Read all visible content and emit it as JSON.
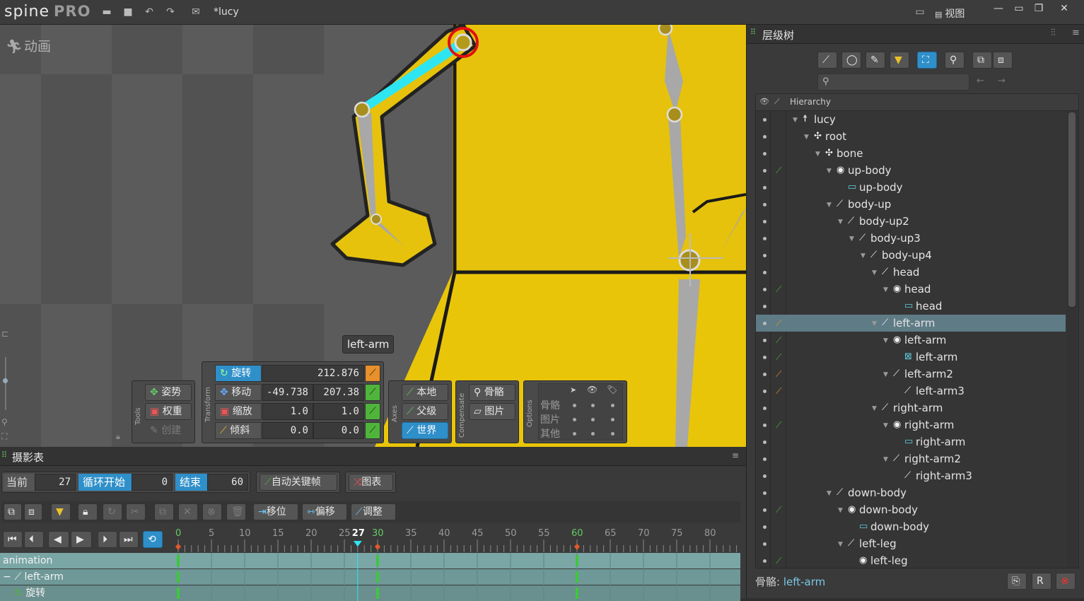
{
  "app": {
    "logo": "spine",
    "edition": "PRO",
    "filename": "*lucy",
    "view_menu": "视图"
  },
  "viewport": {
    "title": "动画",
    "bone_label": "left-arm"
  },
  "tools": {
    "label": "Tools",
    "pose": "姿势",
    "weights": "权重",
    "create": "创建"
  },
  "transform": {
    "label": "Transform",
    "rows": [
      {
        "name": "旋转",
        "v1": "212.876",
        "v2": "",
        "key": "orange",
        "active": true
      },
      {
        "name": "移动",
        "v1": "-49.738",
        "v2": "207.38",
        "key": "green",
        "active": false
      },
      {
        "name": "缩放",
        "v1": "1.0",
        "v2": "1.0",
        "key": "green",
        "active": false
      },
      {
        "name": "倾斜",
        "v1": "0.0",
        "v2": "0.0",
        "key": "green",
        "active": false
      }
    ]
  },
  "axes": {
    "label": "Axes",
    "local": "本地",
    "parent": "父级",
    "world": "世界"
  },
  "compensate": {
    "label": "Compensate",
    "bones": "骨骼",
    "images": "图片"
  },
  "options": {
    "label": "Options",
    "rows": [
      "骨骼",
      "图片",
      "其他"
    ]
  },
  "timeline": {
    "title": "摄影表",
    "current_label": "当前",
    "current": "27",
    "loop_start_label": "循环开始",
    "loop_start": "0",
    "end_label": "结束",
    "end": "60",
    "autokey": "自动关键帧",
    "graph": "图表",
    "offset_btn": "移位",
    "shift_btn": "偏移",
    "adjust_btn": "调整",
    "ticks": [
      "0",
      "5",
      "10",
      "15",
      "20",
      "25",
      "27",
      "30",
      "35",
      "40",
      "45",
      "50",
      "55",
      "60",
      "65",
      "70",
      "75",
      "80"
    ],
    "tracks": [
      "animation",
      "left-arm",
      "旋转"
    ]
  },
  "tree": {
    "title": "层级树",
    "column": "Hierarchy",
    "status_prefix": "骨骼:",
    "status_value": "left-arm",
    "items": [
      {
        "label": "lucy",
        "depth": 0,
        "icon": "skeleton",
        "key": ""
      },
      {
        "label": "root",
        "depth": 1,
        "icon": "bone-root",
        "key": ""
      },
      {
        "label": "bone",
        "depth": 2,
        "icon": "bone-root",
        "key": ""
      },
      {
        "label": "up-body",
        "depth": 3,
        "icon": "slot",
        "key": "green"
      },
      {
        "label": "up-body",
        "depth": 4,
        "icon": "image",
        "key": ""
      },
      {
        "label": "body-up",
        "depth": 3,
        "icon": "bone",
        "key": ""
      },
      {
        "label": "body-up2",
        "depth": 4,
        "icon": "bone",
        "key": ""
      },
      {
        "label": "body-up3",
        "depth": 5,
        "icon": "bone",
        "key": ""
      },
      {
        "label": "body-up4",
        "depth": 6,
        "icon": "bone",
        "key": ""
      },
      {
        "label": "head",
        "depth": 7,
        "icon": "bone",
        "key": ""
      },
      {
        "label": "head",
        "depth": 8,
        "icon": "slot",
        "key": "green"
      },
      {
        "label": "head",
        "depth": 9,
        "icon": "image",
        "key": ""
      },
      {
        "label": "left-arm",
        "depth": 7,
        "icon": "bone",
        "key": "orange",
        "selected": true
      },
      {
        "label": "left-arm",
        "depth": 8,
        "icon": "slot",
        "key": "green"
      },
      {
        "label": "left-arm",
        "depth": 9,
        "icon": "mesh",
        "key": "green"
      },
      {
        "label": "left-arm2",
        "depth": 8,
        "icon": "bone",
        "key": "orange"
      },
      {
        "label": "left-arm3",
        "depth": 9,
        "icon": "bone",
        "key": "orange"
      },
      {
        "label": "right-arm",
        "depth": 7,
        "icon": "bone",
        "key": ""
      },
      {
        "label": "right-arm",
        "depth": 8,
        "icon": "slot",
        "key": "green"
      },
      {
        "label": "right-arm",
        "depth": 9,
        "icon": "image",
        "key": ""
      },
      {
        "label": "right-arm2",
        "depth": 8,
        "icon": "bone",
        "key": ""
      },
      {
        "label": "right-arm3",
        "depth": 9,
        "icon": "bone",
        "key": ""
      },
      {
        "label": "down-body",
        "depth": 3,
        "icon": "bone",
        "key": ""
      },
      {
        "label": "down-body",
        "depth": 4,
        "icon": "slot",
        "key": "green"
      },
      {
        "label": "down-body",
        "depth": 5,
        "icon": "image",
        "key": ""
      },
      {
        "label": "left-leg",
        "depth": 4,
        "icon": "bone",
        "key": ""
      },
      {
        "label": "left-leg",
        "depth": 5,
        "icon": "slot",
        "key": "green"
      }
    ]
  }
}
